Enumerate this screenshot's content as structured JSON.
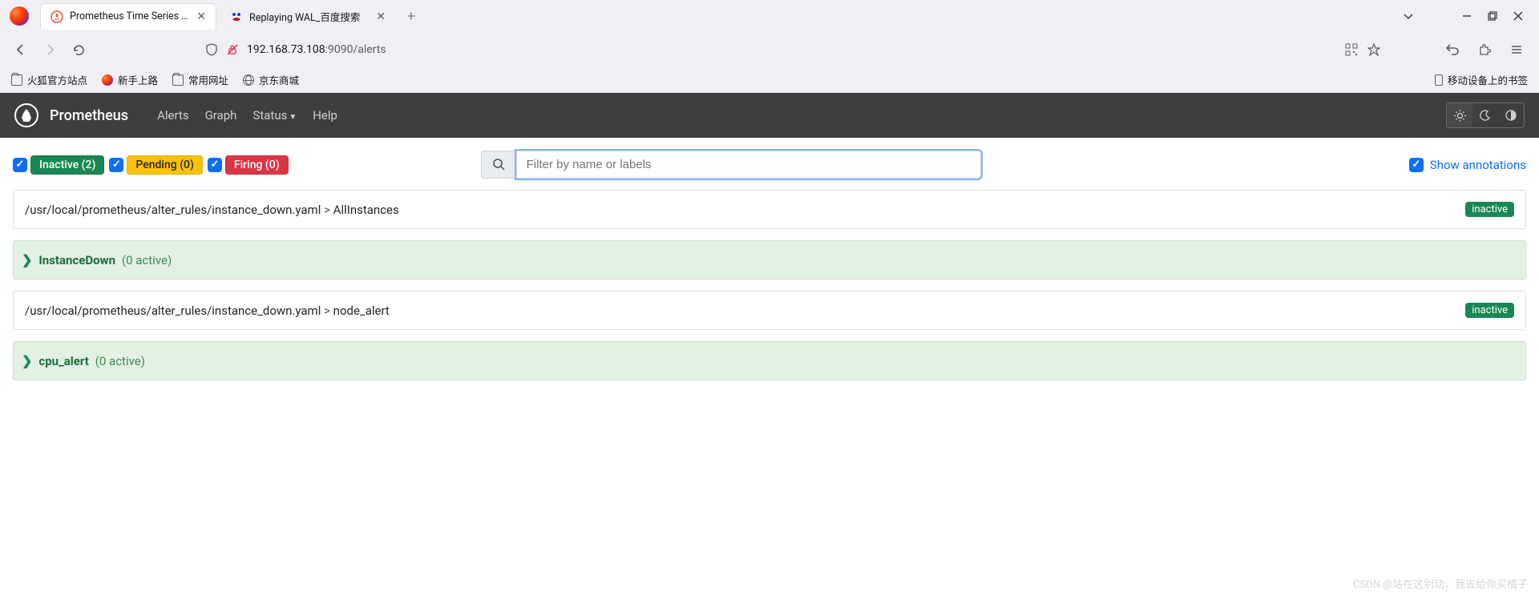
{
  "browser": {
    "tabs": [
      {
        "title": "Prometheus Time Series Colle",
        "active": true
      },
      {
        "title": "Replaying WAL_百度搜索",
        "active": false
      }
    ],
    "url_host": "192.168.73.108",
    "url_port_path": ":9090/alerts",
    "bookmarks": [
      {
        "label": "火狐官方站点",
        "type": "folder"
      },
      {
        "label": "新手上路",
        "type": "firefox"
      },
      {
        "label": "常用网址",
        "type": "folder"
      },
      {
        "label": "京东商城",
        "type": "globe"
      }
    ],
    "mobile_bookmarks": "移动设备上的书签"
  },
  "prom_nav": {
    "brand": "Prometheus",
    "links": [
      "Alerts",
      "Graph",
      "Status",
      "Help"
    ]
  },
  "filters": {
    "inactive_label": "Inactive (2)",
    "pending_label": "Pending (0)",
    "firing_label": "Firing (0)",
    "search_placeholder": "Filter by name or labels",
    "show_annotations": "Show annotations"
  },
  "groups": [
    {
      "path": "/usr/local/prometheus/alter_rules/instance_down.yaml",
      "sep": ">",
      "name": "AllInstances",
      "status": "inactive",
      "rules": [
        {
          "name": "InstanceDown",
          "count": "(0 active)"
        }
      ]
    },
    {
      "path": "/usr/local/prometheus/alter_rules/instance_down.yaml",
      "sep": ">",
      "name": "node_alert",
      "status": "inactive",
      "rules": [
        {
          "name": "cpu_alert",
          "count": "(0 active)"
        }
      ]
    }
  ],
  "watermark": "CSDN @站在这别动，我去给你买橘子"
}
